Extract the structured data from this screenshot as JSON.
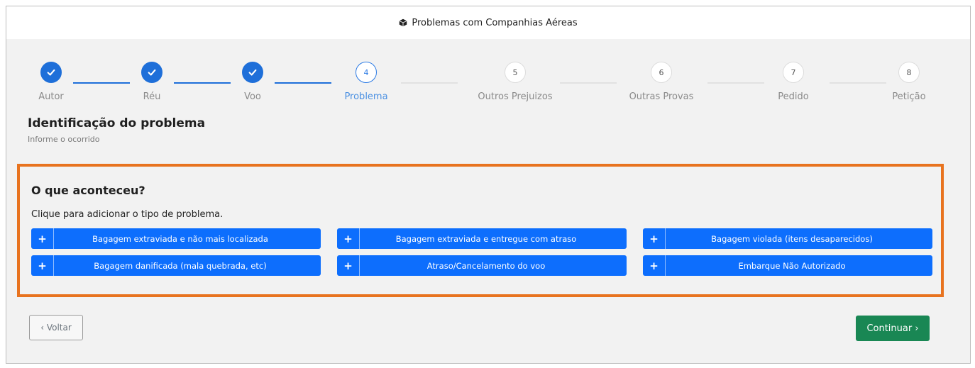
{
  "window": {
    "title": "Problemas com Companhias Aéreas",
    "icon": "box-icon"
  },
  "stepper": {
    "steps": [
      {
        "number": "1",
        "label": "Autor",
        "state": "done"
      },
      {
        "number": "2",
        "label": "Réu",
        "state": "done"
      },
      {
        "number": "3",
        "label": "Voo",
        "state": "done"
      },
      {
        "number": "4",
        "label": "Problema",
        "state": "active"
      },
      {
        "number": "5",
        "label": "Outros Prejuizos",
        "state": "pending"
      },
      {
        "number": "6",
        "label": "Outras Provas",
        "state": "pending"
      },
      {
        "number": "7",
        "label": "Pedido",
        "state": "pending"
      },
      {
        "number": "8",
        "label": "Petição",
        "state": "pending"
      }
    ],
    "completed_icon": "check-icon"
  },
  "section": {
    "title": "Identificação do problema",
    "subtitle": "Informe o ocorrido"
  },
  "panel": {
    "title": "O que aconteceu?",
    "instruction": "Clique para adicionar o tipo de problema.",
    "plus_symbol": "+",
    "buttons": [
      {
        "label": "Bagagem extraviada e não mais localizada"
      },
      {
        "label": "Bagagem extraviada e entregue com atraso"
      },
      {
        "label": "Bagagem violada (itens desaparecidos)"
      },
      {
        "label": "Bagagem danificada (mala quebrada, etc)"
      },
      {
        "label": "Atraso/Cancelamento do voo"
      },
      {
        "label": "Embarque Não Autorizado"
      }
    ]
  },
  "footer": {
    "back_label": "‹ Voltar",
    "next_label": "Continuar ›"
  },
  "colors": {
    "primary": "#0d6efd",
    "done": "#1e6fd9",
    "success": "#198754",
    "highlight": "#e8731f"
  }
}
